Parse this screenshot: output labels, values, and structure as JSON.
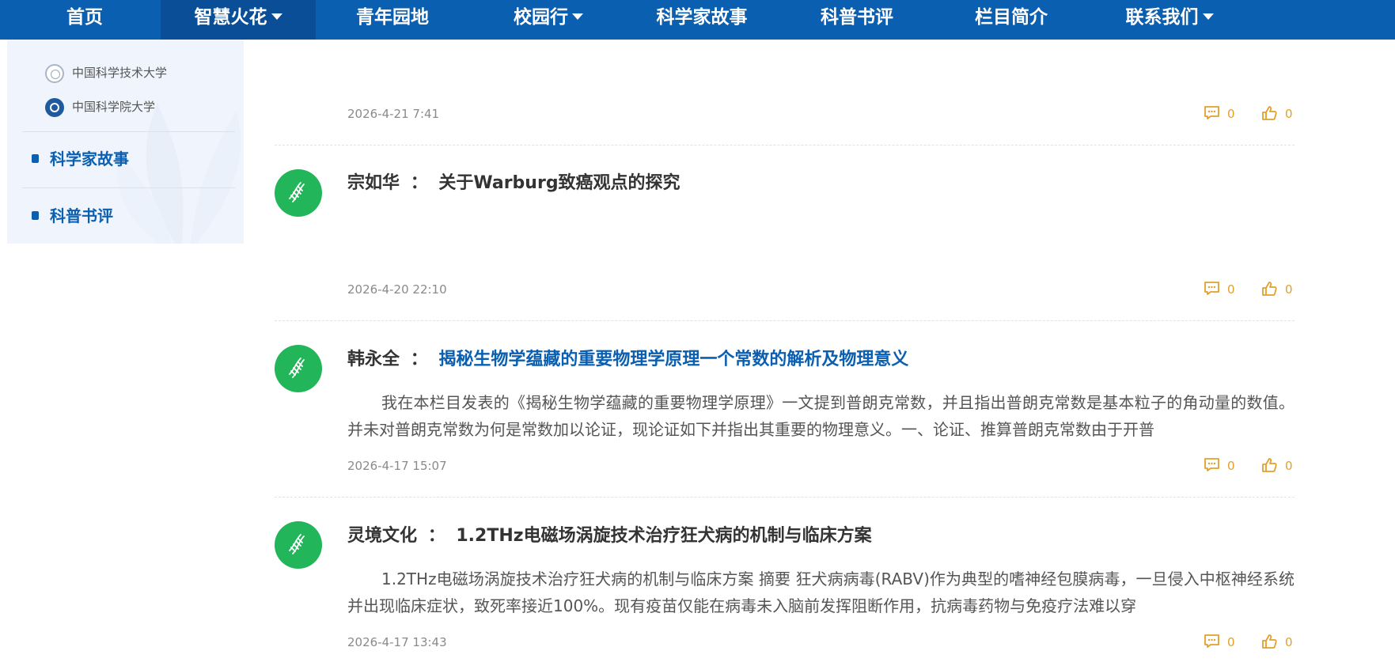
{
  "nav": {
    "items": [
      {
        "label": "首页"
      },
      {
        "label": "智慧火花"
      },
      {
        "label": "青年园地"
      },
      {
        "label": "校园行"
      },
      {
        "label": "科学家故事"
      },
      {
        "label": "科普书评"
      },
      {
        "label": "栏目简介"
      },
      {
        "label": "联系我们"
      }
    ]
  },
  "sidebar": {
    "universities": [
      {
        "name": "中国科学技术大学"
      },
      {
        "name": "中国科学院大学"
      }
    ],
    "categories": [
      {
        "label": "科学家故事"
      },
      {
        "label": "科普书评"
      }
    ]
  },
  "posts": [
    {
      "date": "2026-4-21 7:41",
      "comments": "0",
      "likes": "0"
    },
    {
      "author": "宗如华",
      "separator": "：",
      "title": "关于Warburg致癌观点的探究",
      "date": "2026-4-20 22:10",
      "comments": "0",
      "likes": "0"
    },
    {
      "author": "韩永全",
      "separator": "：",
      "title": "揭秘生物学蕴藏的重要物理学原理一个常数的解析及物理意义",
      "excerpt": "我在本栏目发表的《揭秘生物学蕴藏的重要物理学原理》一文提到普朗克常数，并且指出普朗克常数是基本粒子的角动量的数值。并未对普朗克常数为何是常数加以论证，现论证如下并指出其重要的物理意义。一、论证、推算普朗克常数由于开普",
      "date": "2026-4-17 15:07",
      "comments": "0",
      "likes": "0"
    },
    {
      "author": "灵境文化",
      "separator": "：",
      "title": "1.2THz电磁场涡旋技术治疗狂犬病的机制与临床方案",
      "excerpt": "1.2THz电磁场涡旋技术治疗狂犬病的机制与临床方案  摘要 狂犬病病毒(RABV)作为典型的嗜神经包膜病毒，一旦侵入中枢神经系统并出现临床症状，致死率接近100%。现有疫苗仅能在病毒未入脑前发挥阻断作用，抗病毒药物与免疫疗法难以穿",
      "date": "2026-4-17 13:43",
      "comments": "0",
      "likes": "0"
    }
  ],
  "colors": {
    "nav_bg": "#0b5fb0",
    "nav_active_bg": "#0a4e98",
    "link_blue": "#0b5fb0",
    "avatar_green": "#22b55a",
    "stat_orange": "#e2a02a",
    "sidebar_bg": "#f0f5fd"
  },
  "icons": {
    "nav_dropdown": "caret-down-icon",
    "avatar": "dna-icon",
    "comment": "comment-icon",
    "like": "thumbs-up-icon",
    "category": "square-bullet-icon"
  }
}
